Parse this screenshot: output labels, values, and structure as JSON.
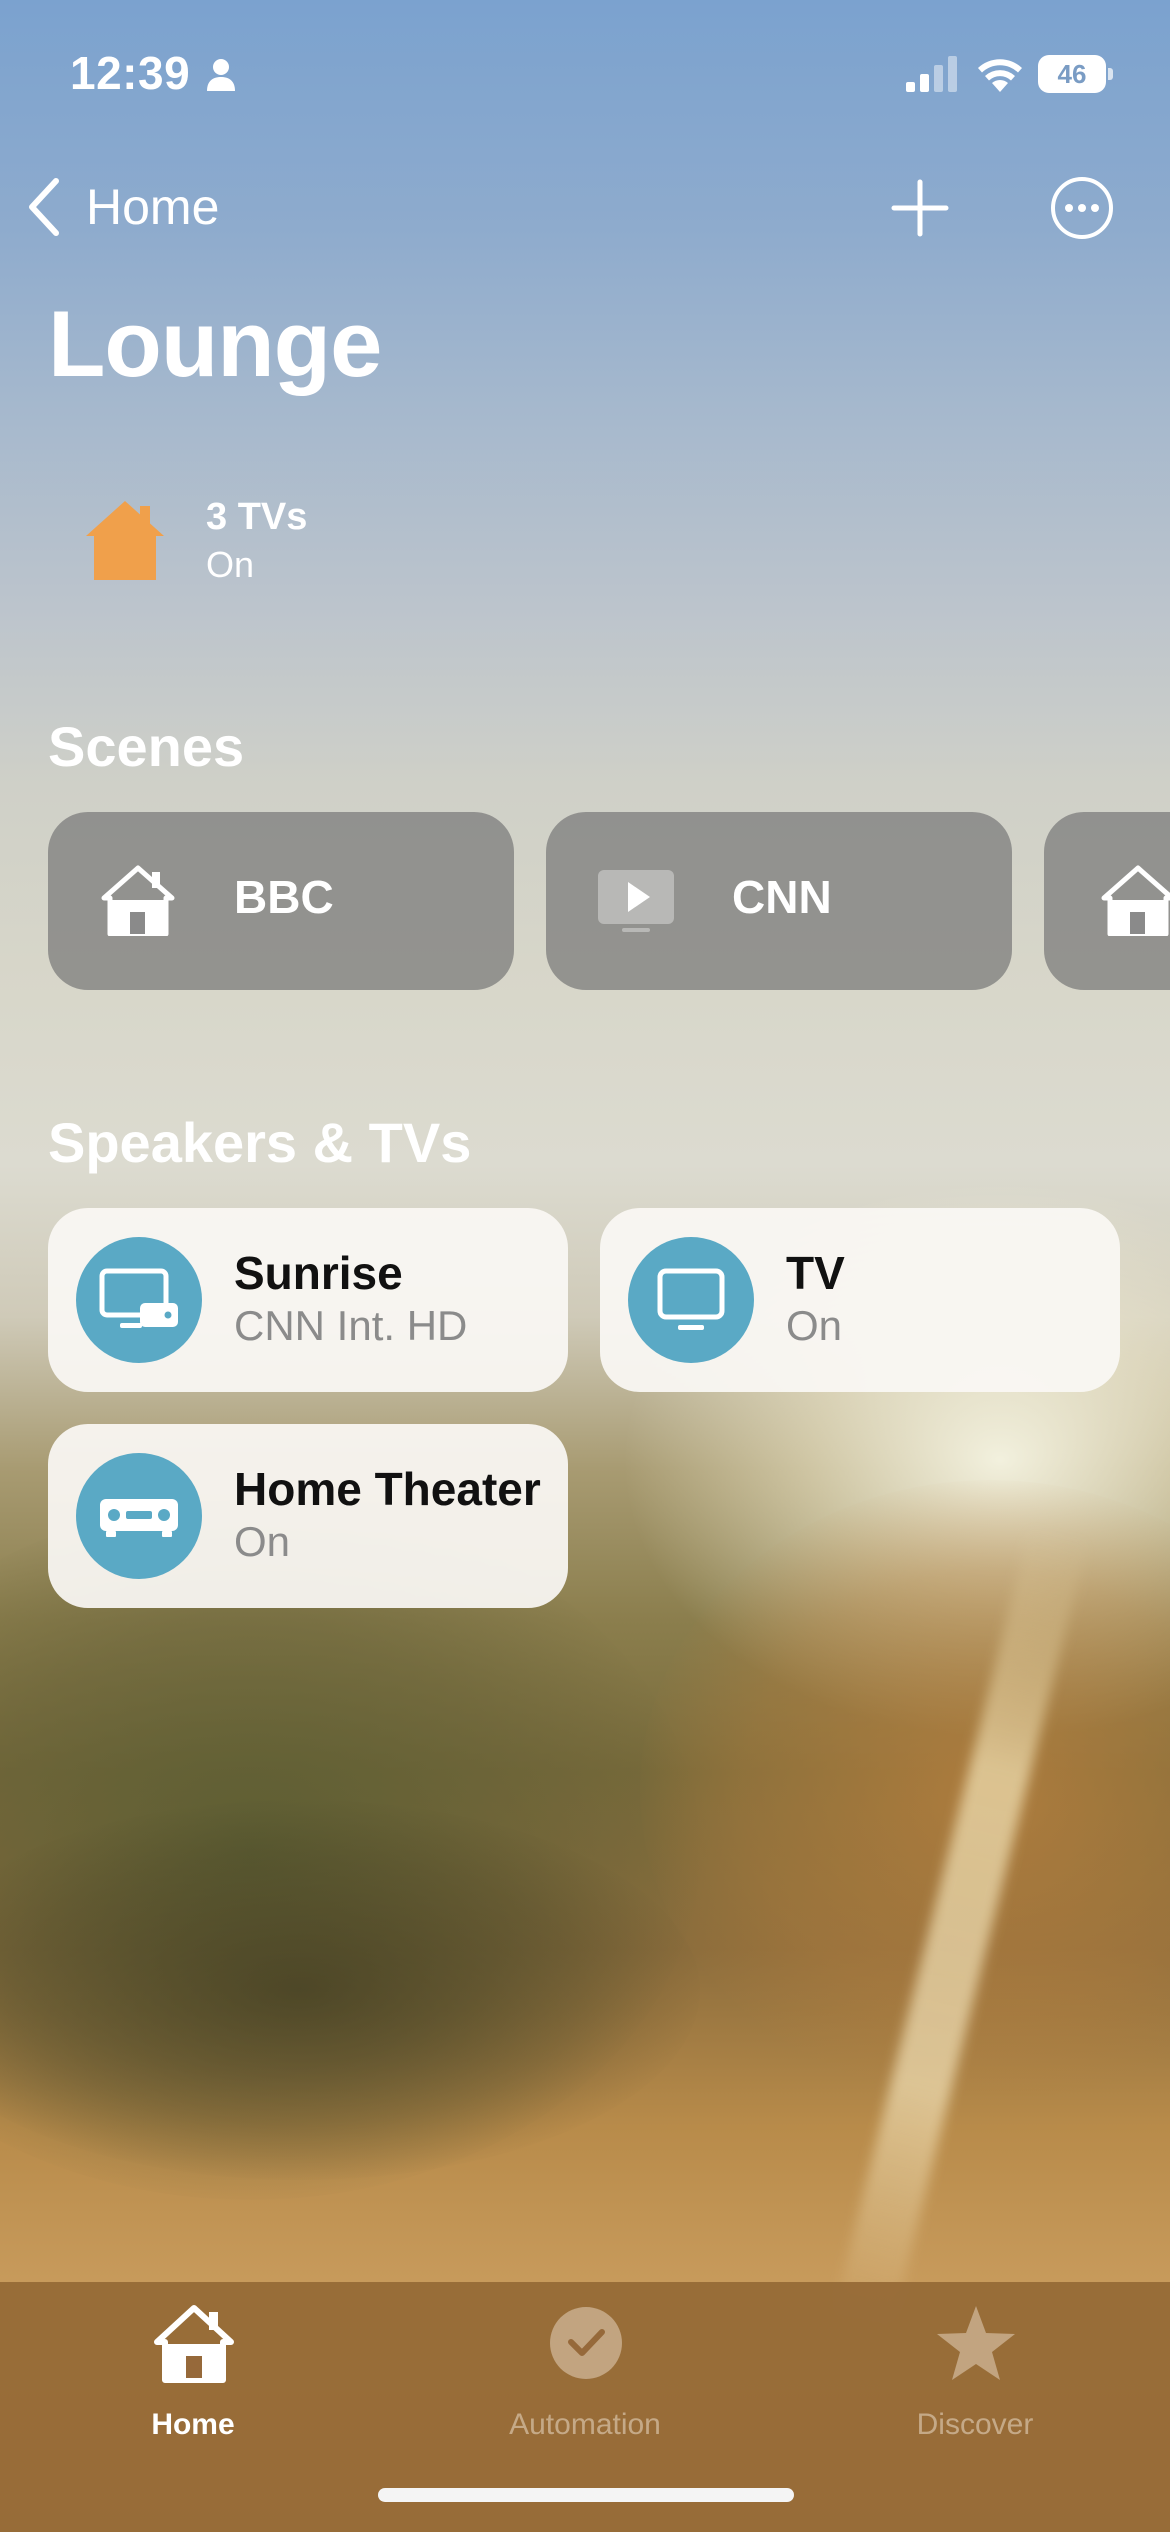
{
  "status_bar": {
    "time": "12:39",
    "battery": "46"
  },
  "nav": {
    "back_label": "Home"
  },
  "page": {
    "title": "Lounge"
  },
  "summary": {
    "title": "3 TVs",
    "status": "On",
    "icon": "house-icon",
    "icon_color": "#f0a04b"
  },
  "scenes": {
    "title": "Scenes",
    "items": [
      {
        "label": "BBC",
        "icon": "house-icon"
      },
      {
        "label": "CNN",
        "icon": "play-icon"
      },
      {
        "label": "",
        "icon": "house-icon"
      }
    ]
  },
  "devices": {
    "title": "Speakers & TVs",
    "accent": "#5aa9c5",
    "items": [
      {
        "name": "Sunrise",
        "status": "CNN Int. HD",
        "icon": "tv-box-icon"
      },
      {
        "name": "TV",
        "status": "On",
        "icon": "tv-icon"
      },
      {
        "name": "Home Theater",
        "status": "On",
        "icon": "receiver-icon"
      }
    ]
  },
  "tab_bar": {
    "items": [
      {
        "label": "Home",
        "icon": "house-icon",
        "active": true
      },
      {
        "label": "Automation",
        "icon": "clock-check-icon",
        "active": false
      },
      {
        "label": "Discover",
        "icon": "star-icon",
        "active": false
      }
    ]
  }
}
